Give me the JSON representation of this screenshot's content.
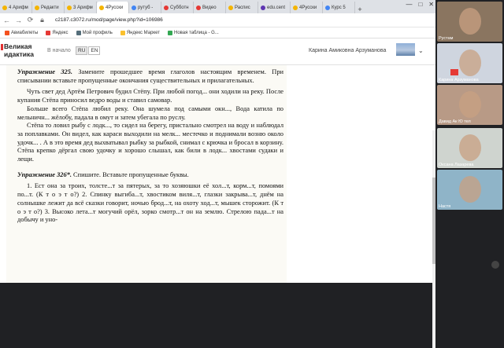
{
  "browser": {
    "tabs": [
      {
        "label": "4 Арифм",
        "color": "#f4b400"
      },
      {
        "label": "Редакти",
        "color": "#f4b400"
      },
      {
        "label": "3 Арифм",
        "color": "#f4b400"
      },
      {
        "label": "4Русски",
        "color": "#f4b400",
        "active": true
      },
      {
        "label": "рутуб -",
        "color": "#4285f4"
      },
      {
        "label": "Субботн",
        "color": "#e53935"
      },
      {
        "label": "Видео",
        "color": "#e53935"
      },
      {
        "label": "Распис",
        "color": "#f4b400"
      },
      {
        "label": "edu.cent",
        "color": "#5e35b1"
      },
      {
        "label": "4Русски",
        "color": "#f4b400"
      },
      {
        "label": "Курс 5",
        "color": "#4285f4"
      }
    ],
    "new_tab": "+",
    "controls": [
      "—",
      "□",
      "✕"
    ],
    "url": "c2187.c3072.ru/mod/page/view.php?id=106986",
    "bookmarks": [
      {
        "label": "Авиабилеты",
        "color": "#f4511e"
      },
      {
        "label": "Яндекс",
        "color": "#e53935"
      },
      {
        "label": "Мой профиль",
        "color": "#546e7a"
      },
      {
        "label": "Яндекс Маркет",
        "color": "#fbc02d"
      },
      {
        "label": "Новая таблица - G...",
        "color": "#34a853"
      }
    ]
  },
  "site": {
    "logo_line1": "Великая",
    "logo_line2": "идактика",
    "offline": "В начало",
    "lang": [
      "RU",
      "EN"
    ],
    "user": "Карина Амиковна Арзуманова"
  },
  "document": {
    "ex325_title": "Упражнение 325.",
    "ex325_text": "Замените прошедшее время глаголов настоящим временем. При списывании вставьте пропущенные окончания существительных и прилагательных.",
    "p1": "Чуть свет дед Артём Петрович будил Стёпу. При любой погод... они ходили на реку. После купания Стёпа приносил ведро воды и ставил самовар.",
    "p2": "Больше всего Стёпа любил реку. Она шумела под самыми окн..., Вода катила по мельничн... жёлобу, падала в омут и затем убегала по руслу.",
    "p3": "Стёпа то ловил рыбу с лодк..., то сидел на берегу, пристально смотрел на воду и наблюдал за поплавками. Он видел, как караси выходили на мелк... местечко и поднимали возню около удочк... . А в это время дед выхватывал рыбку за рыбкой, снимал с крючка и бросал в корзину. Стёпа крепко дёргал свою удочку и хорошо слышал, как били в лодк... хвостами судаки и лещи.",
    "ex326_title": "Упражнение 326*.",
    "ex326_text": "Спишите. Вставьте пропущенные буквы.",
    "p4": "1. Ест она за троих, толсте...т за пятерых, за то хозяюшки её хол...т, корм...т, помоями по...т. (К т о  э т о?) 2. Спинку выгиба...т, хвостиком виля...т, глазки закрыва...т, днём на солнышке лежит да всё сказки говорит, ночью брод...т, на охоту ход...т, мышек сторожит. (К т о  э т о?) 3. Высоко лета...т могучий орёл, зорко смотр...т он на землю. Стрелою пада...т на добычу и уно-"
  },
  "participants": [
    {
      "name": "Рустам",
      "bg": "#8a7560"
    },
    {
      "name": "Карина Арзуманова",
      "bg": "#cfd5df"
    },
    {
      "name": "Давид Ак Ю тел",
      "bg": "#b89a86"
    },
    {
      "name": "Оксана Лазарева",
      "bg": "#cfd4cf"
    },
    {
      "name": "Настя",
      "bg": "#8fb4c8"
    }
  ]
}
